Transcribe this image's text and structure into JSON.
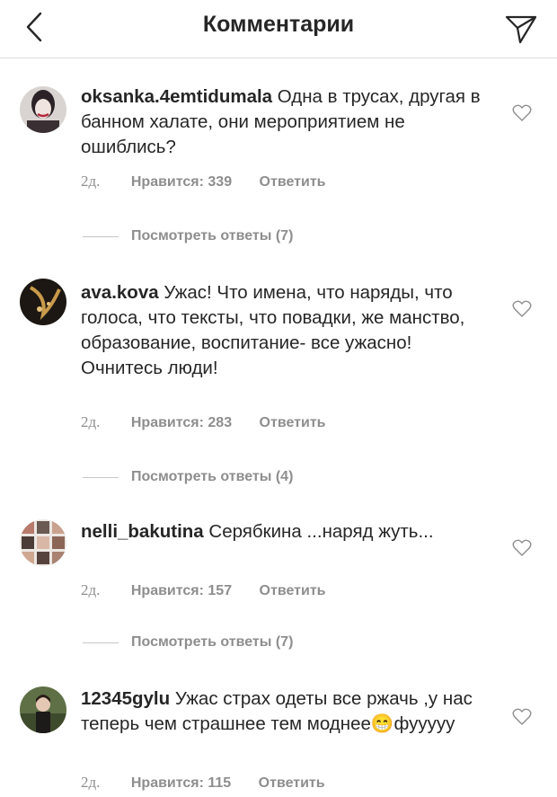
{
  "header": {
    "title": "Комментарии"
  },
  "comments": [
    {
      "username": "oksanka.4emtidumala",
      "text": "Одна в трусах, другая в банном халате, они мероприятием не ошиблись?",
      "time": "2д.",
      "likes": "Нравится: 339",
      "reply": "Ответить",
      "view_replies": "Посмотреть ответы (7)"
    },
    {
      "username": "ava.kova",
      "text": "Ужас! Что имена, что наряды, что голоса, что тексты, что повадки, же манство, образование, воспитание- все ужасно! Очнитесь люди!",
      "time": "2д.",
      "likes": "Нравится: 283",
      "reply": "Ответить",
      "view_replies": "Посмотреть ответы (4)"
    },
    {
      "username": "nelli_bakutina",
      "text": "Серябкина ...наряд жуть...",
      "time": "2д.",
      "likes": "Нравится: 157",
      "reply": "Ответить",
      "view_replies": "Посмотреть ответы (7)"
    },
    {
      "username": "12345gylu",
      "text_before": "Ужас страх одеты все ржачь ,у нас теперь чем страшнее тем моднее",
      "emoji": "😁",
      "text_after": "фууууу",
      "time": "2д.",
      "likes": "Нравится: 115",
      "reply": "Ответить"
    }
  ],
  "colors": {
    "text": "#262626",
    "secondary": "#8e8e8e",
    "divider": "#dbdbdb"
  },
  "icons": [
    "chevron-left-icon",
    "send-icon",
    "heart-icon"
  ]
}
